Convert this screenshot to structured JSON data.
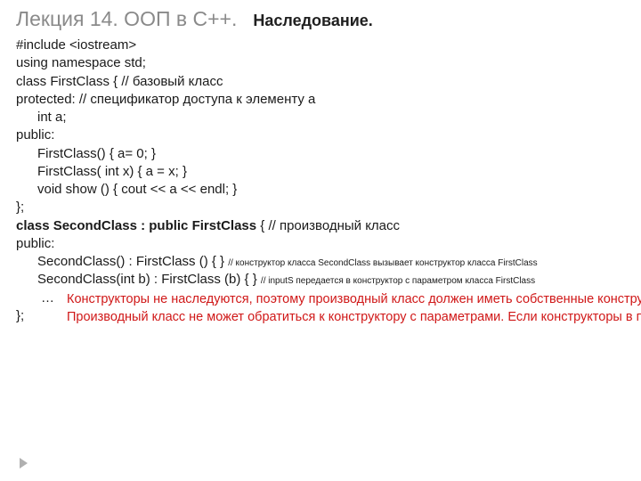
{
  "title": {
    "main": "Лекция 14. ООП в С++.",
    "sub": "Наследование."
  },
  "code": {
    "l1": "#include <iostream>",
    "l2": "using namespace std;",
    "l3a": "class FirstClass  {",
    "l3c": "   // базовый класс",
    "l4a": "protected:",
    "l4c": "          // спецификатор доступа к элементу а",
    "l5": "int a;",
    "l6": "public:",
    "l7": "FirstClass()  { a= 0; }",
    "l8": "FirstClass( int x)  { a = x; }",
    "l9": " void show ()  { cout << a << endl; }",
    "l10": "};",
    "l11a": "class SecondClass : public FirstClass",
    "l11b": "  {  // производный класс",
    "l12": "public:",
    "l13a": "SecondClass() : FirstClass ()  { } ",
    "l13c": "// конструктор класса SecondClass вызывает конструктор класса FirstClass",
    "l14a": "SecondClass(int b) : FirstClass (b) { } ",
    "l14c": "// inputS передается в конструктор с параметром класса FirstClass",
    "l15": "…",
    "l16": "};"
  },
  "note": {
    "p1": "Конструкторы не наследуются, поэтому производный класс должен иметь собственные конструкторы.",
    "p2": "Производный класс не может обратиться к конструктору с параметрами. Если конструкторы в производном классе не определены, при создании объекта сработает конструктор без аргументов базового класса. А если нам надо сразу при создании объекта производного класса внести данные, то для него необходимо определить свои конструкторы."
  }
}
